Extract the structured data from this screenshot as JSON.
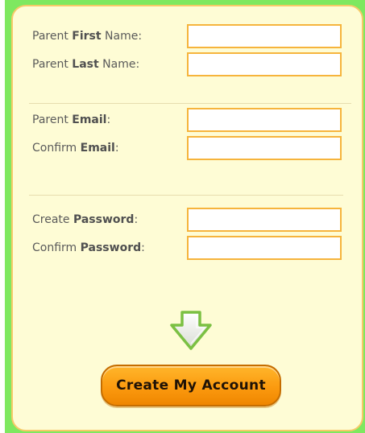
{
  "form": {
    "parent_first_name": {
      "prefix": "Parent ",
      "bold": "First",
      "suffix": " Name:",
      "value": ""
    },
    "parent_last_name": {
      "prefix": "Parent ",
      "bold": "Last",
      "suffix": " Name:",
      "value": ""
    },
    "parent_email": {
      "prefix": "Parent ",
      "bold": "Email",
      "suffix": ":",
      "value": ""
    },
    "confirm_email": {
      "prefix": "Confirm ",
      "bold": "Email",
      "suffix": ":",
      "value": ""
    },
    "create_password": {
      "prefix": "Create ",
      "bold": "Password",
      "suffix": ":",
      "value": ""
    },
    "confirm_password": {
      "prefix": "Confirm ",
      "bold": "Password",
      "suffix": ":",
      "value": ""
    }
  },
  "submit": {
    "label": "Create My Account"
  },
  "icons": {
    "arrow": "down-arrow-icon"
  },
  "colors": {
    "panel_bg": "#fefcd5",
    "panel_border": "#f7c968",
    "side_bar": "#7ee860",
    "field_border": "#f6b43c",
    "button": "#fb9a0f",
    "arrow": "#7bc043"
  }
}
